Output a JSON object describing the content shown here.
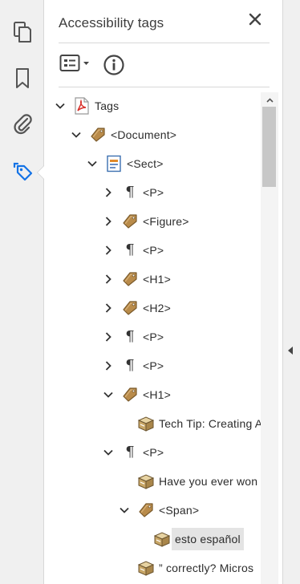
{
  "panel": {
    "title": "Accessibility tags",
    "options_icon": "tag-options-icon",
    "info_icon": "info-icon",
    "close_icon": "close-icon"
  },
  "rail": {
    "items": [
      {
        "name": "pages-icon"
      },
      {
        "name": "bookmarks-icon"
      },
      {
        "name": "attachments-icon"
      },
      {
        "name": "tags-icon",
        "active": true
      }
    ]
  },
  "tree": {
    "nodes": [
      {
        "label": "Tags",
        "depth": 0,
        "icon": "pdf",
        "state": "expanded"
      },
      {
        "label": "<Document>",
        "depth": 1,
        "icon": "tag",
        "state": "expanded"
      },
      {
        "label": "<Sect>",
        "depth": 2,
        "icon": "section",
        "state": "expanded"
      },
      {
        "label": "<P>",
        "depth": 3,
        "icon": "pilcrow",
        "state": "collapsed"
      },
      {
        "label": "<Figure>",
        "depth": 3,
        "icon": "tag",
        "state": "collapsed"
      },
      {
        "label": "<P>",
        "depth": 3,
        "icon": "pilcrow",
        "state": "collapsed"
      },
      {
        "label": "<H1>",
        "depth": 3,
        "icon": "tag",
        "state": "collapsed"
      },
      {
        "label": "<H2>",
        "depth": 3,
        "icon": "tag",
        "state": "collapsed"
      },
      {
        "label": "<P>",
        "depth": 3,
        "icon": "pilcrow",
        "state": "collapsed"
      },
      {
        "label": "<P>",
        "depth": 3,
        "icon": "pilcrow",
        "state": "collapsed"
      },
      {
        "label": "<H1>",
        "depth": 3,
        "icon": "tag",
        "state": "expanded"
      },
      {
        "label": "Tech Tip: Creating A",
        "depth": 4,
        "icon": "content",
        "state": "leaf"
      },
      {
        "label": "<P>",
        "depth": 3,
        "icon": "pilcrow",
        "state": "expanded"
      },
      {
        "label": "Have you ever won",
        "depth": 4,
        "icon": "content",
        "state": "leaf"
      },
      {
        "label": "<Span>",
        "depth": 4,
        "icon": "tag",
        "state": "expanded"
      },
      {
        "label": "esto español",
        "depth": 5,
        "icon": "content",
        "state": "leaf",
        "selected": true
      },
      {
        "label": "” correctly?  Micros",
        "depth": 4,
        "icon": "content",
        "state": "leaf"
      }
    ]
  },
  "colors": {
    "active_icon": "#1473e6",
    "tag_brown": "#a87c3e",
    "pdf_red": "#d8302a",
    "selection": "#e4e4e4"
  }
}
